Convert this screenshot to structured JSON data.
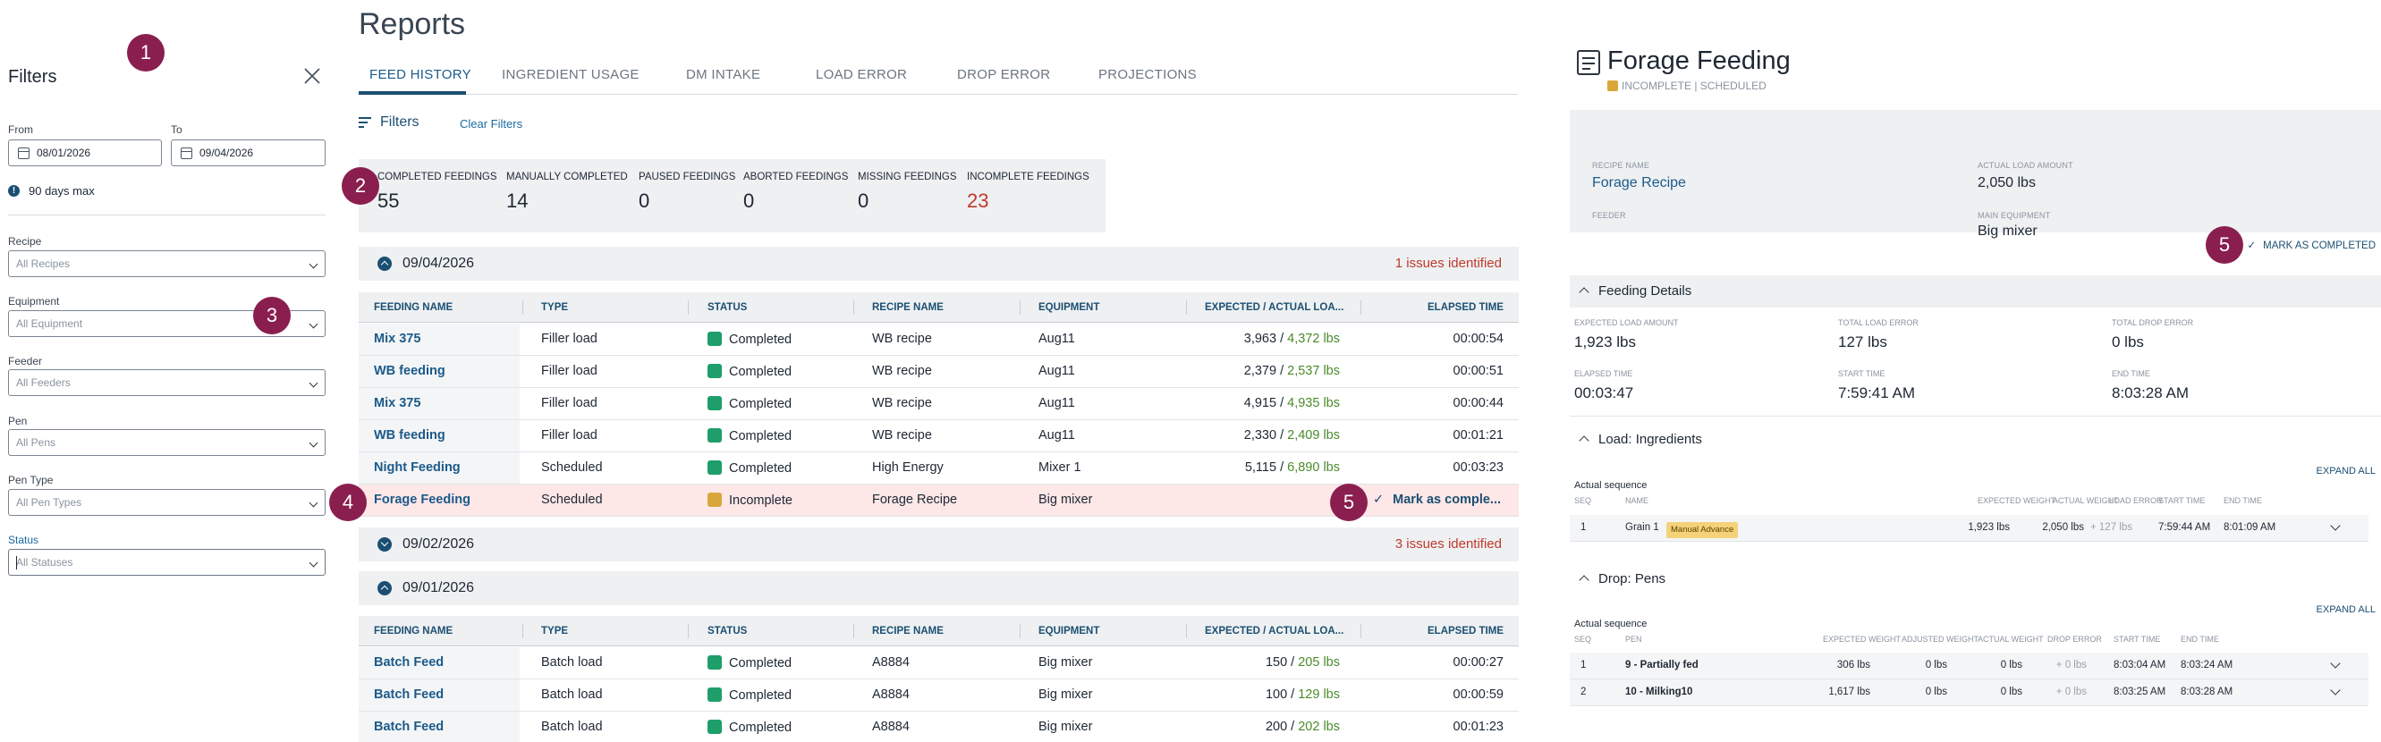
{
  "badges": {
    "b1": "1",
    "b2": "2",
    "b3": "3",
    "b4": "4",
    "b5a": "5",
    "b5b": "5"
  },
  "filters": {
    "title": "Filters",
    "from_label": "From",
    "to_label": "To",
    "from_value": "08/01/2026",
    "to_value": "09/04/2026",
    "limit_note": "90 days max",
    "recipe_label": "Recipe",
    "recipe_value": "All Recipes",
    "equipment_label": "Equipment",
    "equipment_value": "All Equipment",
    "feeder_label": "Feeder",
    "feeder_value": "All Feeders",
    "pen_label": "Pen",
    "pen_value": "All Pens",
    "pen_type_label": "Pen Type",
    "pen_type_value": "All Pen Types",
    "status_label": "Status",
    "status_value": "All Statuses"
  },
  "page_title": "Reports",
  "tabs": [
    "FEED HISTORY",
    "INGREDIENT USAGE",
    "DM INTAKE",
    "LOAD ERROR",
    "DROP ERROR",
    "PROJECTIONS"
  ],
  "toolbar": {
    "filters_label": "Filters",
    "clear_label": "Clear Filters"
  },
  "summary": [
    {
      "label": "COMPLETED FEEDINGS",
      "value": "55"
    },
    {
      "label": "MANUALLY COMPLETED",
      "value": "14"
    },
    {
      "label": "PAUSED FEEDINGS",
      "value": "0"
    },
    {
      "label": "ABORTED FEEDINGS",
      "value": "0"
    },
    {
      "label": "MISSING FEEDINGS",
      "value": "0"
    },
    {
      "label": "INCOMPLETE FEEDINGS",
      "value": "23"
    }
  ],
  "columns": [
    "FEEDING NAME",
    "TYPE",
    "STATUS",
    "RECIPE NAME",
    "EQUIPMENT",
    "EXPECTED / ACTUAL LOA...",
    "ELAPSED TIME"
  ],
  "groups": [
    {
      "date": "09/04/2026",
      "issues": "1 issues identified",
      "rows": [
        {
          "name": "Mix 375",
          "type": "Filler load",
          "status": "Completed",
          "recipe": "WB recipe",
          "equipment": "Aug11",
          "expected": "3,963",
          "actual": "4,372 lbs",
          "elapsed": "00:00:54"
        },
        {
          "name": "WB feeding",
          "type": "Filler load",
          "status": "Completed",
          "recipe": "WB recipe",
          "equipment": "Aug11",
          "expected": "2,379",
          "actual": "2,537 lbs",
          "elapsed": "00:00:51"
        },
        {
          "name": "Mix 375",
          "type": "Filler load",
          "status": "Completed",
          "recipe": "WB recipe",
          "equipment": "Aug11",
          "expected": "4,915",
          "actual": "4,935 lbs",
          "elapsed": "00:00:44"
        },
        {
          "name": "WB feeding",
          "type": "Filler load",
          "status": "Completed",
          "recipe": "WB recipe",
          "equipment": "Aug11",
          "expected": "2,330",
          "actual": "2,409 lbs",
          "elapsed": "00:01:21"
        },
        {
          "name": "Night Feeding",
          "type": "Scheduled",
          "status": "Completed",
          "recipe": "High Energy",
          "equipment": "Mixer 1",
          "expected": "5,115",
          "actual": "6,890 lbs",
          "elapsed": "00:03:23"
        },
        {
          "name": "Forage Feeding",
          "type": "Scheduled",
          "status": "Incomplete",
          "recipe": "Forage Recipe",
          "equipment": "Big mixer",
          "mark_label": "Mark as comple..."
        }
      ]
    },
    {
      "date": "09/02/2026",
      "issues": "3 issues identified"
    },
    {
      "date": "09/01/2026",
      "rows": [
        {
          "name": "Batch Feed",
          "type": "Batch load",
          "status": "Completed",
          "recipe": "A8884",
          "equipment": "Big mixer",
          "expected": "150",
          "actual": "205 lbs",
          "elapsed": "00:00:27"
        },
        {
          "name": "Batch Feed",
          "type": "Batch load",
          "status": "Completed",
          "recipe": "A8884",
          "equipment": "Big mixer",
          "expected": "100",
          "actual": "129 lbs",
          "elapsed": "00:00:59"
        },
        {
          "name": "Batch Feed",
          "type": "Batch load",
          "status": "Completed",
          "recipe": "A8884",
          "equipment": "Big mixer",
          "expected": "200",
          "actual": "202 lbs",
          "elapsed": "00:01:23"
        }
      ]
    }
  ],
  "detail": {
    "title": "Forage Feeding",
    "status_text": "INCOMPLETE | SCHEDULED",
    "recipe_name_label": "RECIPE NAME",
    "recipe_name": "Forage Recipe",
    "actual_load_label": "ACTUAL LOAD AMOUNT",
    "actual_load": "2,050 lbs",
    "feeder_label": "FEEDER",
    "main_equipment_label": "MAIN EQUIPMENT",
    "main_equipment": "Big mixer",
    "mark_completed": "MARK AS COMPLETED",
    "details_title": "Feeding Details",
    "expected_load_label": "EXPECTED LOAD AMOUNT",
    "expected_load": "1,923 lbs",
    "total_load_error_label": "TOTAL LOAD ERROR",
    "total_load_error": "127 lbs",
    "total_drop_error_label": "TOTAL DROP ERROR",
    "total_drop_error": "0 lbs",
    "elapsed_label": "ELAPSED TIME",
    "elapsed": "00:03:47",
    "start_label": "START TIME",
    "start": "7:59:41 AM",
    "end_label": "END TIME",
    "end": "8:03:28 AM",
    "load_title": "Load: Ingredients",
    "expand_all": "EXPAND ALL",
    "actual_sequence": "Actual sequence",
    "load_cols": [
      "SEQ",
      "NAME",
      "EXPECTED WEIGHT",
      "ACTUAL WEIGHT",
      "LOAD ERROR",
      "START TIME",
      "END TIME"
    ],
    "load_rows": [
      {
        "seq": "1",
        "name": "Grain 1",
        "tag": "Manual Advance",
        "expected": "1,923 lbs",
        "actual": "2,050 lbs",
        "error": "+ 127 lbs",
        "start": "7:59:44 AM",
        "end": "8:01:09 AM"
      }
    ],
    "drop_title": "Drop: Pens",
    "drop_cols": [
      "SEQ",
      "PEN",
      "EXPECTED WEIGHT",
      "ADJUSTED WEIGHT",
      "ACTUAL WEIGHT",
      "DROP ERROR",
      "START TIME",
      "END TIME"
    ],
    "drop_rows": [
      {
        "seq": "1",
        "pen": "9 - Partially fed",
        "expected": "306 lbs",
        "adjusted": "0 lbs",
        "actual": "0 lbs",
        "error": "+ 0 lbs",
        "start": "8:03:04 AM",
        "end": "8:03:24 AM"
      },
      {
        "seq": "2",
        "pen": "10 - Milking10",
        "expected": "1,617 lbs",
        "adjusted": "0 lbs",
        "actual": "0 lbs",
        "error": "+ 0 lbs",
        "start": "8:03:25 AM",
        "end": "8:03:28 AM"
      }
    ]
  },
  "colors": {
    "accent": "#1b4f72",
    "badge": "#8a1f4f",
    "issue": "#c0392b",
    "completed": "#1e9e6a",
    "incomplete": "#d9a63a",
    "actual_green": "#4a8a2a"
  }
}
